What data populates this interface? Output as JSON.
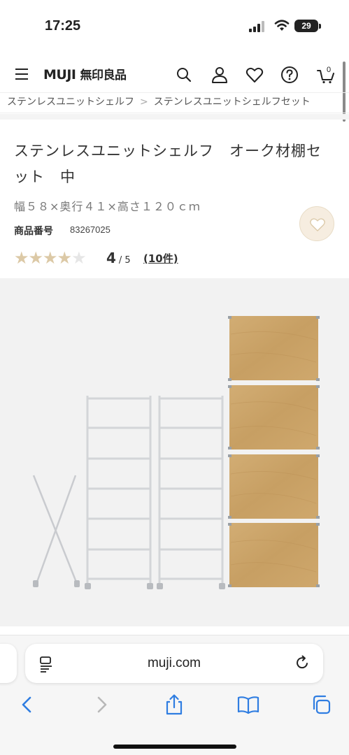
{
  "status_bar": {
    "time": "17:25",
    "battery": "29"
  },
  "header": {
    "logo_en": "MUJI",
    "logo_jp": "無印良品",
    "cart_count": "0"
  },
  "breadcrumb": [
    "ステンレスユニットシェルフ",
    "ステンレスユニットシェルフセット"
  ],
  "product": {
    "title": "ステンレスユニットシェルフ　オーク材棚セット　中",
    "size": "幅５８×奥行４１×高さ１２０ｃｍ",
    "number_label": "商品番号",
    "number_value": "83267025",
    "rating_value": "4",
    "rating_out_of": "/ 5",
    "rating_stars": 4,
    "reviews": "(10件)"
  },
  "browser": {
    "url": "muji.com"
  },
  "colors": {
    "star": "#dcc9a6",
    "wood": "#c9a46a",
    "fav_bg": "#f6ede0",
    "link_blue": "#2f7de1"
  }
}
